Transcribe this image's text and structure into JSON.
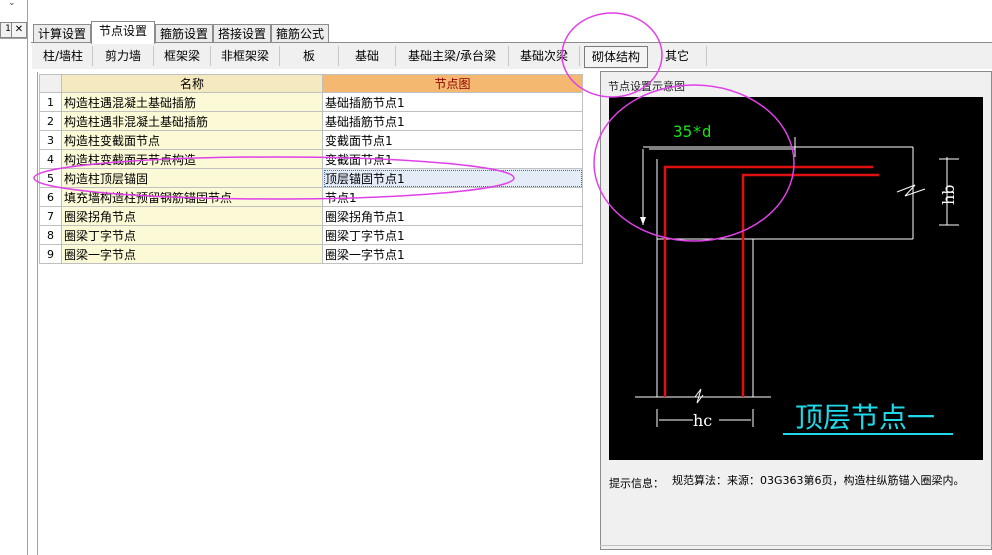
{
  "main_tabs": [
    "计算设置",
    "节点设置",
    "箍筋设置",
    "搭接设置",
    "箍筋公式"
  ],
  "active_main_tab": "节点设置",
  "sub_tabs": [
    "柱/墙柱",
    "剪力墙",
    "框架梁",
    "非框架梁",
    "板",
    "基础",
    "基础主梁/承台梁",
    "基础次梁",
    "砌体结构",
    "其它"
  ],
  "active_sub_tab": "砌体结构",
  "table": {
    "headers": {
      "name": "名称",
      "node": "节点图"
    },
    "rows": [
      {
        "idx": "1",
        "name": "构造柱遇混凝土基础插筋",
        "node": "基础插筋节点1"
      },
      {
        "idx": "2",
        "name": "构造柱遇非混凝土基础插筋",
        "node": "基础插筋节点1"
      },
      {
        "idx": "3",
        "name": "构造柱变截面节点",
        "node": "变截面节点1"
      },
      {
        "idx": "4",
        "name": "构造柱变截面无节点构造",
        "node": "变截面节点1"
      },
      {
        "idx": "5",
        "name": "构造柱顶层锚固",
        "node": "顶层锚固节点1"
      },
      {
        "idx": "6",
        "name": "填充墙构造柱预留钢筋锚固节点",
        "node": "节点1"
      },
      {
        "idx": "7",
        "name": "圈梁拐角节点",
        "node": "圈梁拐角节点1"
      },
      {
        "idx": "8",
        "name": "圈梁丁字节点",
        "node": "圈梁丁字节点1"
      },
      {
        "idx": "9",
        "name": "圈梁一字节点",
        "node": "圈梁一字节点1"
      }
    ],
    "selected_row": 5
  },
  "panel": {
    "title": "节点设置示意图",
    "diagram": {
      "label_anchor": "35*d",
      "label_hb": "hb",
      "label_hc": "hc",
      "caption": "顶层节点一"
    },
    "hint_label": "提示信息：",
    "hint_text": "规范算法：来源：03G363第6页，构造柱纵筋锚入圈梁内。"
  },
  "left_strip": {
    "tab_label": "1",
    "close_glyph": "✕",
    "arrow_glyph": "⌄"
  },
  "colors": {
    "header_node_bg": "#f5b870",
    "header_node_text": "#8b0000",
    "name_cell_bg": "#fbf9d6",
    "annotation_magenta": "#e040e8",
    "rebar_red": "#e01010",
    "diagram_green": "#18e018",
    "diagram_caption_cyan": "#20d8e8"
  }
}
